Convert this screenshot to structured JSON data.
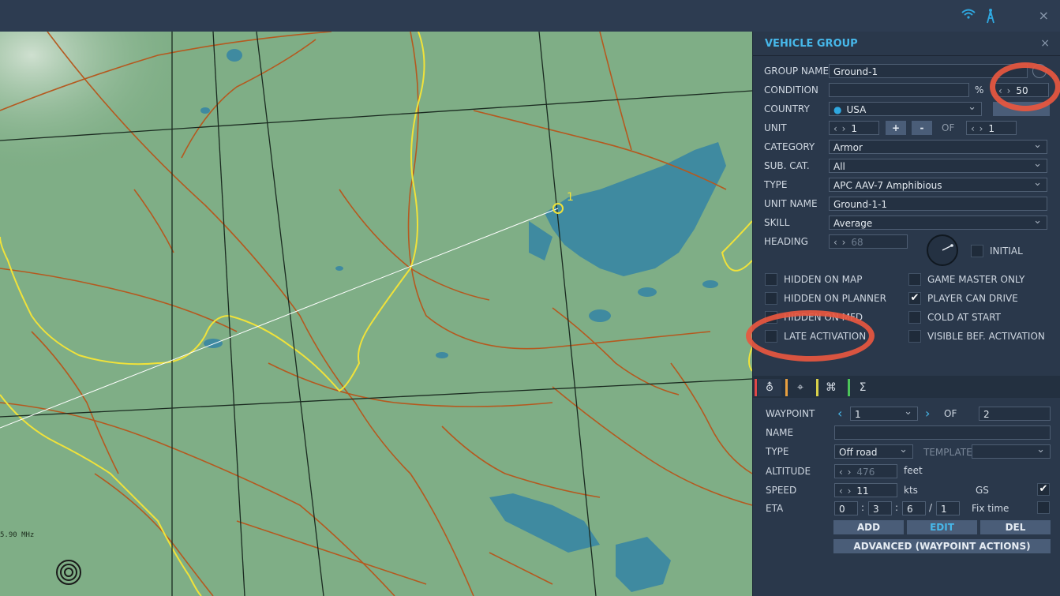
{
  "topbar": {
    "icons": [
      "wifi-icon",
      "radio-tower-icon"
    ],
    "close": "×"
  },
  "map": {
    "waypoint_label": "1",
    "freq_label": "5.90 MHz"
  },
  "panel": {
    "title": "VEHICLE GROUP",
    "close": "×",
    "group_name": {
      "label": "GROUP NAME",
      "value": "Ground-1"
    },
    "condition": {
      "label": "CONDITION",
      "value": "",
      "percent": "%",
      "number": "50"
    },
    "country": {
      "label": "COUNTRY",
      "value": "USA"
    },
    "unit": {
      "label": "UNIT",
      "value": "1",
      "plus": "+",
      "minus": "-",
      "of": "OF",
      "total": "1"
    },
    "category": {
      "label": "CATEGORY",
      "value": "Armor"
    },
    "subcat": {
      "label": "SUB. CAT.",
      "value": "All"
    },
    "type": {
      "label": "TYPE",
      "value": "APC AAV-7 Amphibious"
    },
    "unit_name": {
      "label": "UNIT NAME",
      "value": "Ground-1-1"
    },
    "skill": {
      "label": "SKILL",
      "value": "Average"
    },
    "heading": {
      "label": "HEADING",
      "value": "68",
      "initial": "INITIAL"
    },
    "checks": {
      "hidden_on_map": {
        "label": "HIDDEN ON MAP",
        "checked": false
      },
      "hidden_on_planner": {
        "label": "HIDDEN ON PLANNER",
        "checked": false
      },
      "hidden_on_mfd": {
        "label": "HIDDEN ON MFD",
        "checked": false
      },
      "late_activation": {
        "label": "LATE ACTIVATION",
        "checked": false
      },
      "game_master_only": {
        "label": "GAME MASTER ONLY",
        "checked": false
      },
      "player_can_drive": {
        "label": "PLAYER CAN DRIVE",
        "checked": true
      },
      "cold_at_start": {
        "label": "COLD AT START",
        "checked": false
      },
      "visible_bef_activation": {
        "label": "VISIBLE BEF. ACTIVATION",
        "checked": false
      }
    },
    "tabs": [
      {
        "icon": "route-icon",
        "glyph": "⛢",
        "color": "#e04848"
      },
      {
        "icon": "target-icon",
        "glyph": "⌖",
        "color": "#e8a040"
      },
      {
        "icon": "command-icon",
        "glyph": "⌘",
        "color": "#d9d24a"
      },
      {
        "icon": "sigma-icon",
        "glyph": "Σ",
        "color": "#4cc45a"
      }
    ],
    "waypoint": {
      "label": "WAYPOINT",
      "value": "1",
      "of": "OF",
      "total": "2",
      "name_label": "NAME",
      "name_value": "",
      "type_label": "TYPE",
      "type_value": "Off road",
      "template_label": "TEMPLATE",
      "template_value": "",
      "altitude_label": "ALTITUDE",
      "altitude_value": "476",
      "altitude_unit": "feet",
      "speed_label": "SPEED",
      "speed_value": "11",
      "speed_unit": "kts",
      "gs_label": "GS",
      "gs_checked": true,
      "eta_label": "ETA",
      "eta_d": "0",
      "eta_h": "3",
      "eta_m": "6",
      "eta_s": "1",
      "fix_time_label": "Fix time",
      "fix_time_checked": false
    },
    "buttons": {
      "add": "ADD",
      "edit": "EDIT",
      "del": "DEL",
      "advanced": "ADVANCED (WAYPOINT ACTIONS)"
    }
  },
  "colors": {
    "accent": "#47b8ea",
    "highlight": "#e8573f",
    "road": "#b5591f",
    "border": "#f0e23a",
    "water": "#3f8aa0"
  }
}
